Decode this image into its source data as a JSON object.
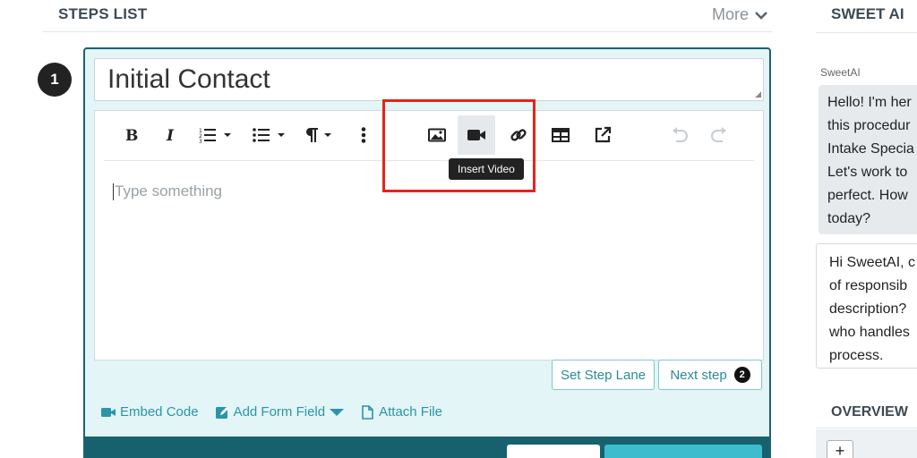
{
  "steps_list": {
    "title": "STEPS LIST",
    "more_label": "More"
  },
  "step": {
    "number": "1",
    "title_value": "Initial Contact",
    "editor_placeholder": "Type something",
    "tooltip": "Insert Video",
    "toolbar_buttons": [
      "bold-icon",
      "italic-icon",
      "ordered-list-icon",
      "bullet-list-icon",
      "paragraph-icon",
      "more-vertical-icon",
      "image-icon",
      "video-icon",
      "link-icon",
      "table-icon",
      "external-link-icon",
      "undo-icon",
      "redo-icon"
    ],
    "set_step_lane_label": "Set Step Lane",
    "next_step_label": "Next step",
    "next_step_badge": "2",
    "links": {
      "embed_code": "Embed Code",
      "add_form_field": "Add Form Field",
      "attach_file": "Attach File"
    }
  },
  "sweet_ai": {
    "title": "SWEET AI",
    "sender_label": "SweetAI",
    "bot_message_lines": [
      "Hello! I'm her",
      "this procedur",
      "Intake Specia",
      "Let's work to",
      "perfect. How",
      "today?"
    ],
    "user_message_lines": [
      "Hi SweetAI, c",
      "of responsib",
      "description?",
      "who handles",
      "process."
    ],
    "overview_title": "OVERVIEW",
    "plus_label": "+"
  },
  "colors": {
    "card_border": "#1b6371",
    "card_bg": "#e3f5f6",
    "accent": "#2a95a8",
    "highlight": "#e5231b",
    "footer": "#17616e"
  }
}
